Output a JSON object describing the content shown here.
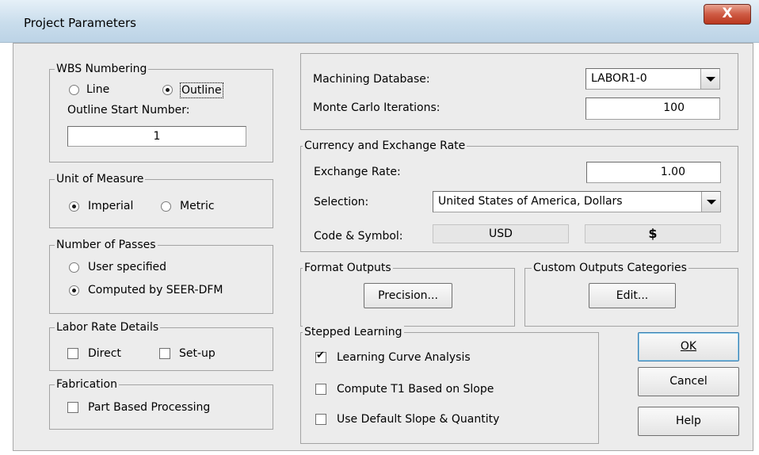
{
  "window": {
    "title": "Project Parameters",
    "close_glyph": "X"
  },
  "wbs": {
    "legend": "WBS Numbering",
    "line_label": "Line",
    "outline_label": "Outline",
    "selected": "outline",
    "start_label": "Outline Start Number:",
    "start_value": "1"
  },
  "unit": {
    "legend": "Unit of Measure",
    "imperial_label": "Imperial",
    "metric_label": "Metric",
    "selected": "imperial"
  },
  "passes": {
    "legend": "Number of Passes",
    "user_label": "User specified",
    "computed_label": "Computed by SEER-DFM",
    "selected": "computed"
  },
  "labor": {
    "legend": "Labor Rate Details",
    "direct_label": "Direct",
    "direct_checked": false,
    "setup_label": "Set-up",
    "setup_checked": false
  },
  "fabrication": {
    "legend": "Fabrication",
    "part_label": "Part Based Processing",
    "part_checked": false
  },
  "machining": {
    "db_label": "Machining Database:",
    "db_value": "LABOR1-0",
    "iter_label": "Monte Carlo Iterations:",
    "iter_value": "100"
  },
  "currency": {
    "legend": "Currency and Exchange Rate",
    "rate_label": "Exchange Rate:",
    "rate_value": "1.00",
    "selection_label": "Selection:",
    "selection_value": "United States of America, Dollars",
    "code_label": "Code & Symbol:",
    "code_value": "USD",
    "symbol_value": "$"
  },
  "format": {
    "legend": "Format Outputs",
    "button": "Precision..."
  },
  "custom": {
    "legend": "Custom Outputs Categories",
    "button": "Edit..."
  },
  "learning": {
    "legend": "Stepped Learning",
    "curve_label": "Learning Curve Analysis",
    "curve_checked": true,
    "t1_label": "Compute T1 Based on Slope",
    "t1_checked": false,
    "default_label": "Use Default Slope & Quantity",
    "default_checked": false
  },
  "actions": {
    "ok": "OK",
    "cancel": "Cancel",
    "help": "Help"
  }
}
